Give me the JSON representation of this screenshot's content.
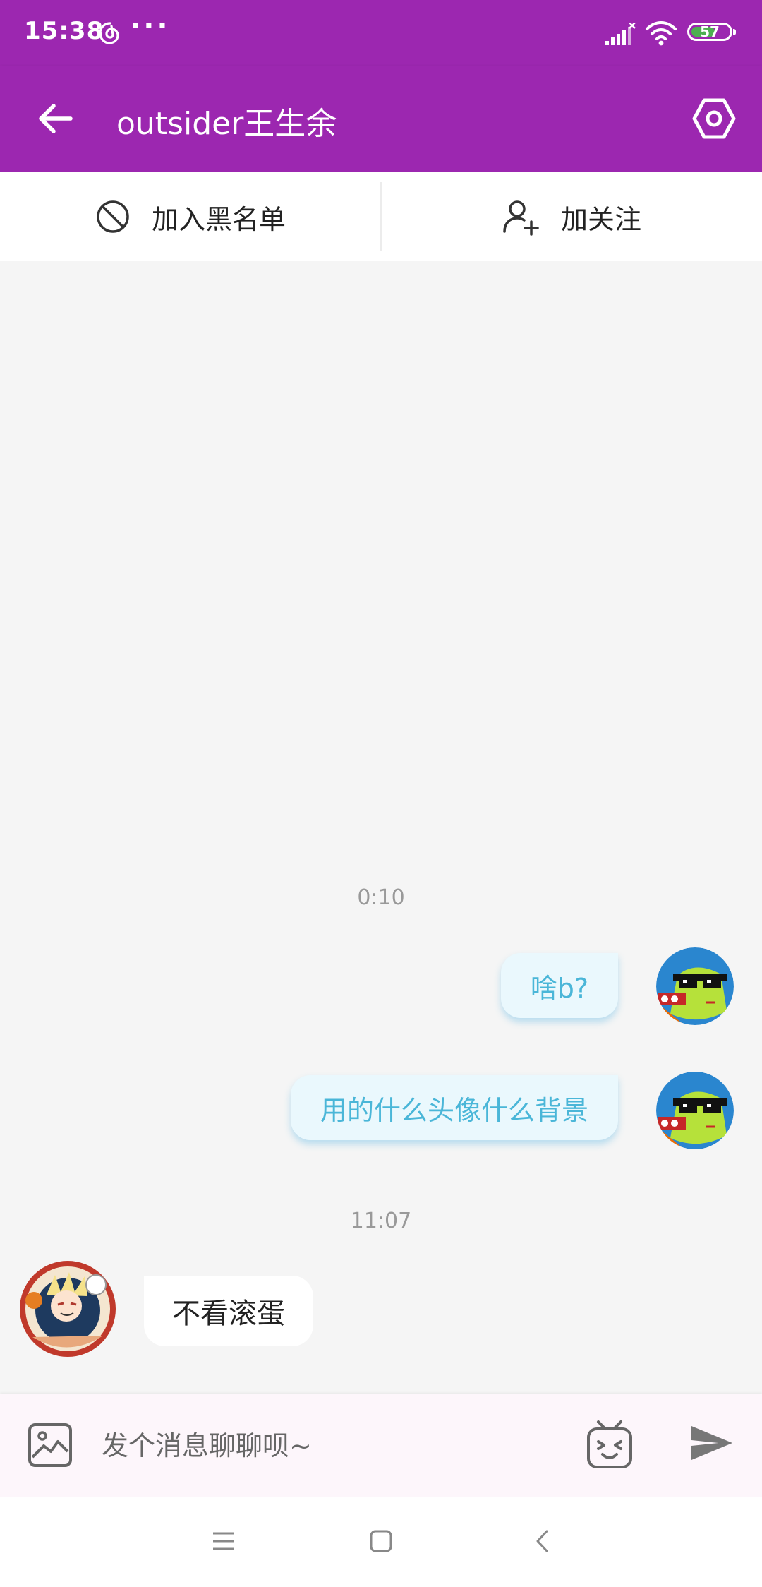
{
  "status_bar": {
    "time": "15:38",
    "more": "···",
    "battery": "57",
    "battery_level": 0.57,
    "icons": [
      "netease-music-icon",
      "signal-icon",
      "wifi-icon",
      "battery-icon"
    ]
  },
  "app_bar": {
    "title": "outsider王生余",
    "back_icon": "arrow-left-icon",
    "settings_icon": "hexagon-settings-icon"
  },
  "actions": {
    "block_label": "加入黑名单",
    "follow_label": "加关注"
  },
  "messages": {
    "time_1": "0:10",
    "out_1": "啥b?",
    "out_2": "用的什么头像什么背景",
    "time_2": "11:07",
    "in_1": "不看滚蛋"
  },
  "input": {
    "placeholder": "发个消息聊聊呗~",
    "value": ""
  },
  "colors": {
    "primary": "#9c27b0",
    "bubble_out_bg": "#eaf8fd",
    "bubble_out_text": "#4ab6d8"
  },
  "nav_bar": {
    "icons": [
      "menu-icon",
      "home-square-icon",
      "back-chevron-icon"
    ]
  }
}
